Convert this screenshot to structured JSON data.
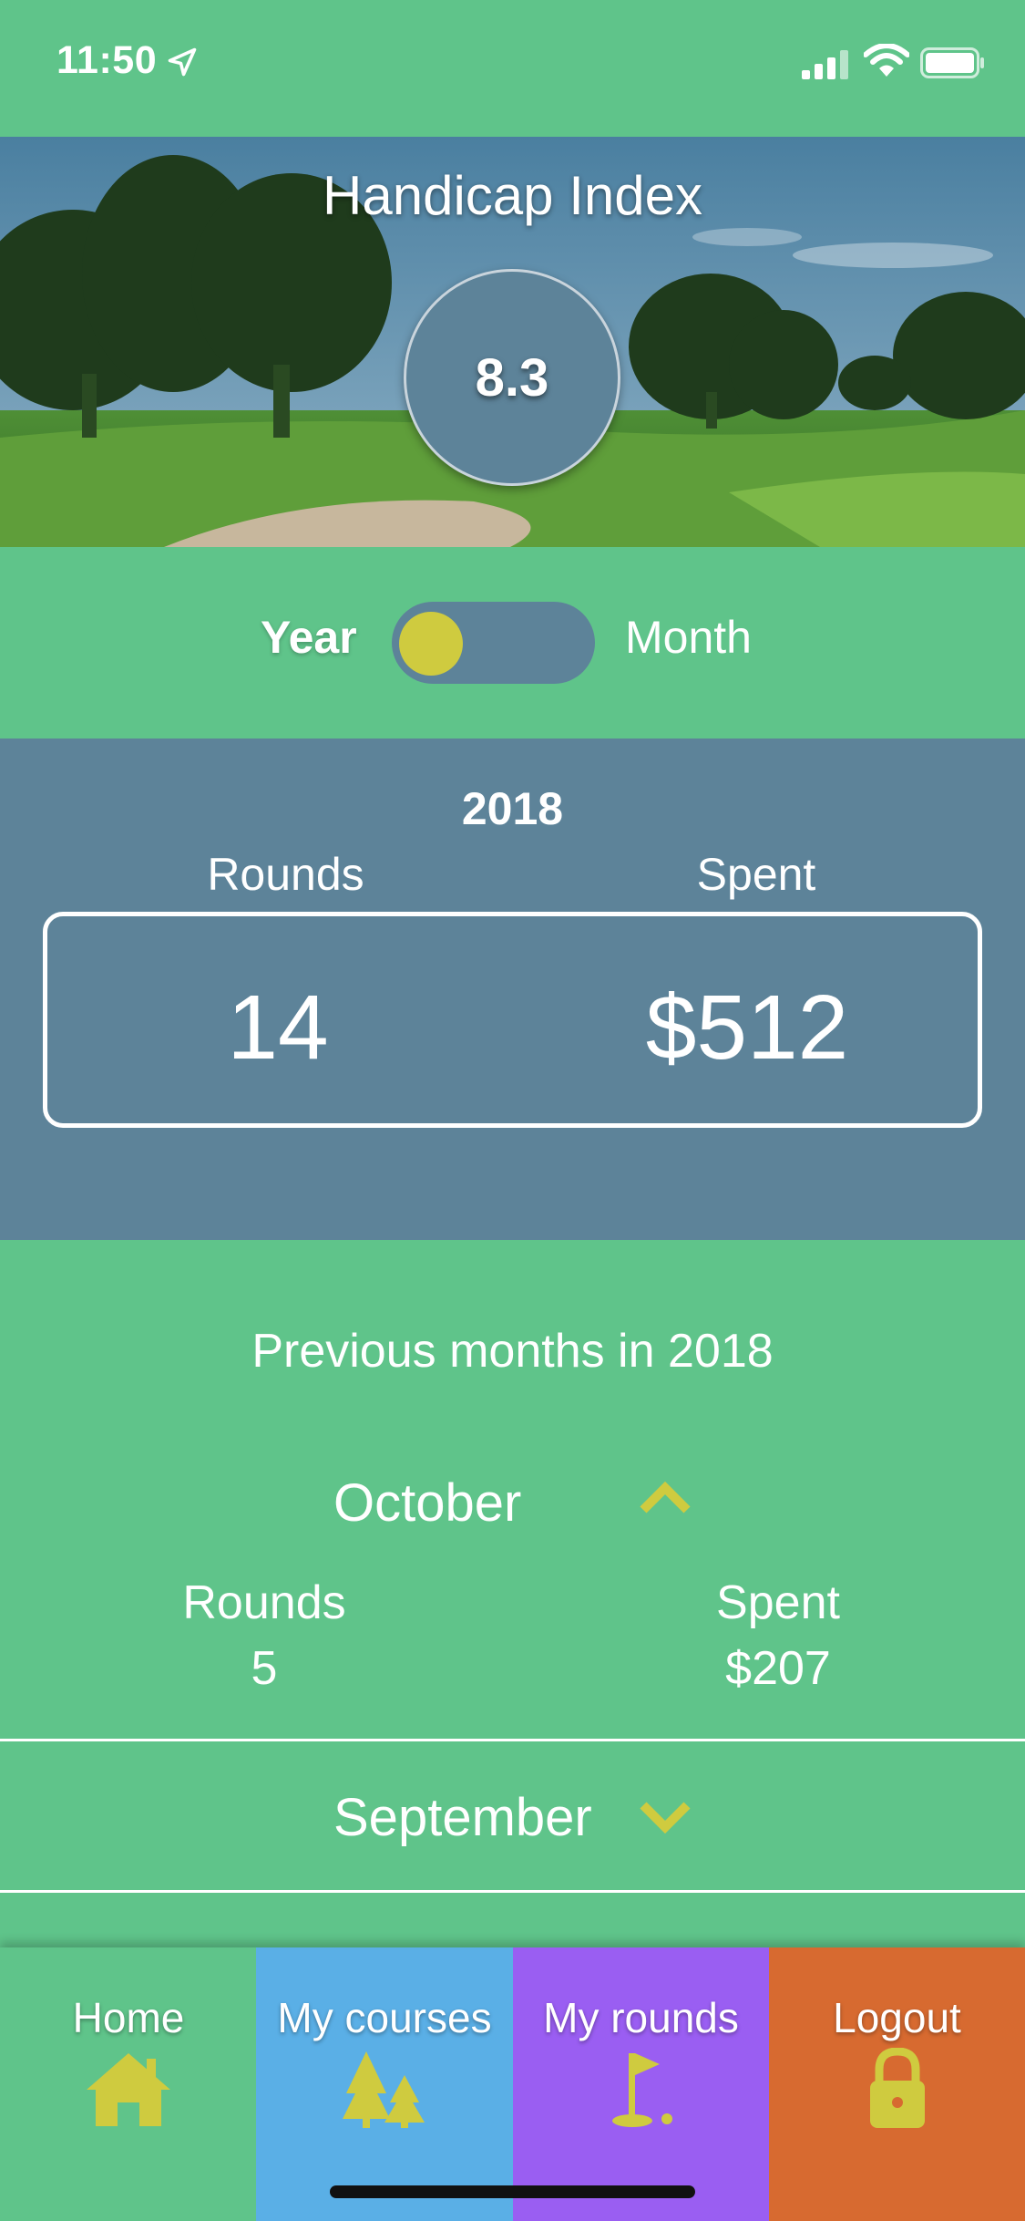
{
  "status_bar": {
    "time": "11:50",
    "icons": [
      "location-arrow-icon",
      "signal-icon",
      "wifi-icon",
      "battery-icon"
    ]
  },
  "hero": {
    "title": "Handicap Index",
    "value": "8.3"
  },
  "toggle": {
    "left_label": "Year",
    "right_label": "Month",
    "selected": "Year"
  },
  "year_summary": {
    "year": "2018",
    "rounds_label": "Rounds",
    "spent_label": "Spent",
    "rounds_value": "14",
    "spent_value": "$512"
  },
  "previous": {
    "title": "Previous months in 2018",
    "months": [
      {
        "name": "October",
        "expanded": true,
        "rounds_label": "Rounds",
        "rounds_value": "5",
        "spent_label": "Spent",
        "spent_value": "$207"
      },
      {
        "name": "September",
        "expanded": false
      }
    ]
  },
  "tabs": [
    {
      "label": "Home",
      "icon": "home-icon",
      "color": "#5fc48a"
    },
    {
      "label": "My courses",
      "icon": "trees-icon",
      "color": "#5aafe6"
    },
    {
      "label": "My rounds",
      "icon": "golf-flag-icon",
      "color": "#9a5ef2"
    },
    {
      "label": "Logout",
      "icon": "lock-icon",
      "color": "#d76a30"
    }
  ],
  "colors": {
    "green": "#5fc48a",
    "slate": "#5d8399",
    "accent_yellow": "#cfcb3f"
  }
}
